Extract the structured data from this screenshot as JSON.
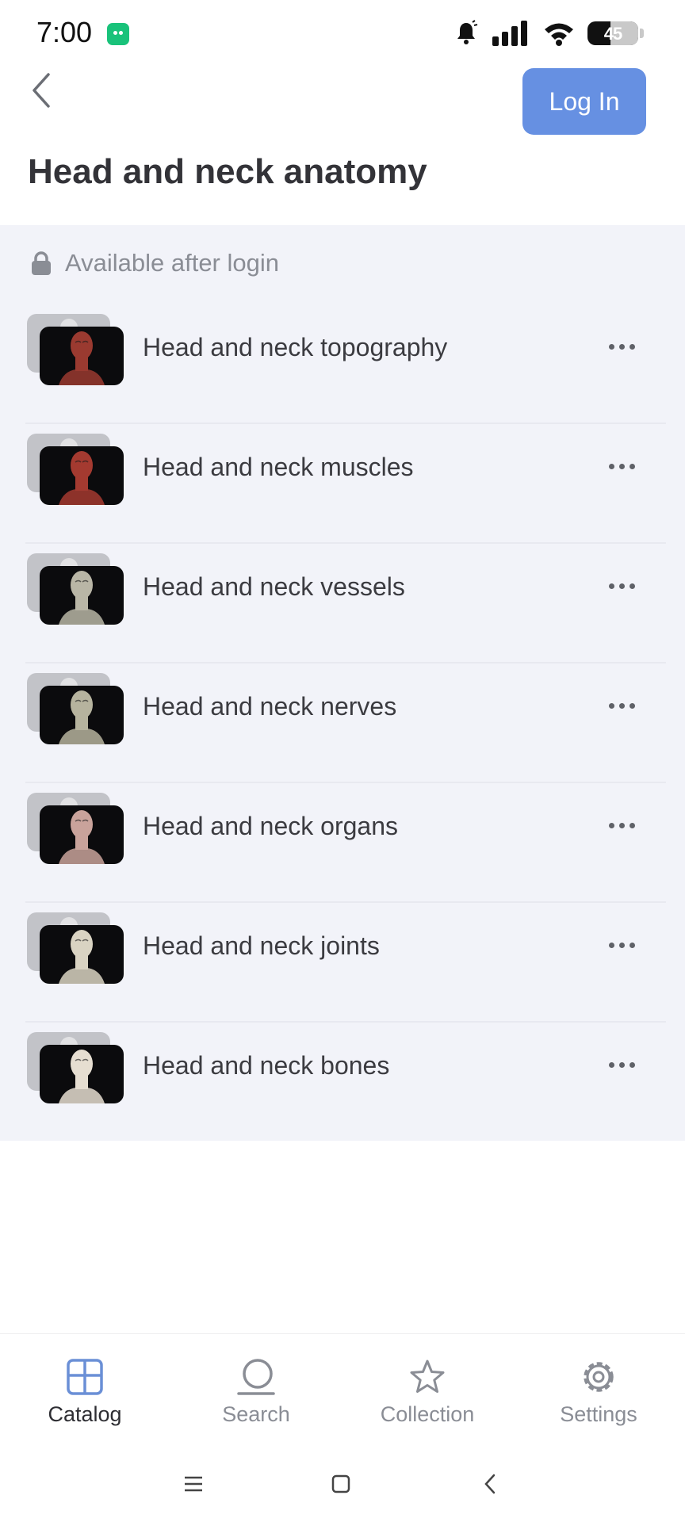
{
  "status_bar": {
    "time": "7:00",
    "battery": "45",
    "icons": [
      "app-notification-icon",
      "bell-icon",
      "signal-icon",
      "wifi-icon",
      "battery-icon"
    ]
  },
  "header": {
    "back_icon": "chevron-left-icon",
    "login_label": "Log In",
    "title": "Head and neck anatomy"
  },
  "section": {
    "lock_icon": "lock-icon",
    "lock_text": "Available after login",
    "items": [
      {
        "label": "Head and neck topography",
        "tint": "#9a3a30"
      },
      {
        "label": "Head and neck muscles",
        "tint": "#a43a30"
      },
      {
        "label": "Head and neck vessels",
        "tint": "#b9b6a6"
      },
      {
        "label": "Head and neck nerves",
        "tint": "#b6b39e"
      },
      {
        "label": "Head and neck organs",
        "tint": "#c9a39b"
      },
      {
        "label": "Head and neck joints",
        "tint": "#d9d3c2"
      },
      {
        "label": "Head and neck bones",
        "tint": "#e6ded1"
      }
    ]
  },
  "bottom_nav": {
    "items": [
      {
        "label": "Catalog",
        "icon": "catalog-grid-icon",
        "active": true
      },
      {
        "label": "Search",
        "icon": "search-icon",
        "active": false
      },
      {
        "label": "Collection",
        "icon": "star-icon",
        "active": false
      },
      {
        "label": "Settings",
        "icon": "gear-icon",
        "active": false
      }
    ]
  },
  "colors": {
    "accent": "#6690e2",
    "active_nav": "#6a8fd6",
    "section_bg": "#f2f3f9"
  }
}
